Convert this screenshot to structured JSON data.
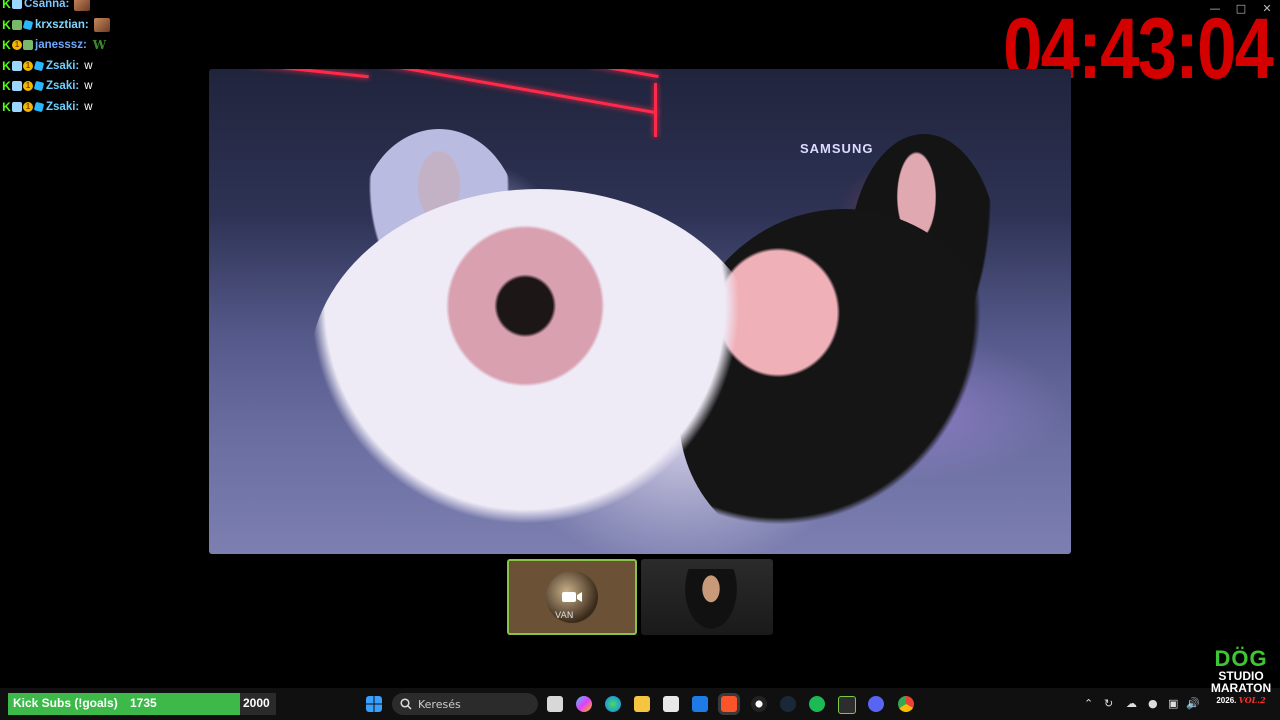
{
  "chat": [
    {
      "badges": [
        "kick",
        "gift"
      ],
      "name": "Csanna",
      "name_color": "#7fc8ff",
      "message": "",
      "emote": "image"
    },
    {
      "badges": [
        "kick",
        "shield",
        "cube"
      ],
      "name": "krxsztian",
      "name_color": "#7fd7ff",
      "message": "",
      "emote": "image"
    },
    {
      "badges": [
        "kick",
        "coin",
        "shield"
      ],
      "name": "janesssz",
      "name_color": "#6fa8ff",
      "message": "",
      "emote": "W"
    },
    {
      "badges": [
        "kick",
        "gift",
        "coin",
        "cube"
      ],
      "name": "Zsaki",
      "name_color": "#6fd0ff",
      "message": "w",
      "emote": ""
    },
    {
      "badges": [
        "kick",
        "gift",
        "coin",
        "cube"
      ],
      "name": "Zsaki",
      "name_color": "#6fd0ff",
      "message": "w",
      "emote": ""
    },
    {
      "badges": [
        "kick",
        "gift",
        "coin",
        "cube"
      ],
      "name": "Zsaki",
      "name_color": "#6fd0ff",
      "message": "w",
      "emote": ""
    }
  ],
  "timer": "04:43:04",
  "main_video": {
    "sign": "SAMSUNG"
  },
  "thumbnails": [
    {
      "type": "avatar",
      "label": "VAN"
    },
    {
      "type": "camera"
    }
  ],
  "goal": {
    "label": "Kick Subs (!goals)",
    "current": "1735",
    "max": "2000",
    "fraction": 0.8675
  },
  "search": {
    "placeholder": "Keresés"
  },
  "logo": {
    "line1": "DÖG",
    "line2": "STUDIO",
    "line3": "MARATON",
    "year": "2026.",
    "vol": "VOL.2"
  },
  "colors": {
    "timer": "#d40000",
    "goal_fill": "#3db94a",
    "kick_green": "#53fc18"
  }
}
